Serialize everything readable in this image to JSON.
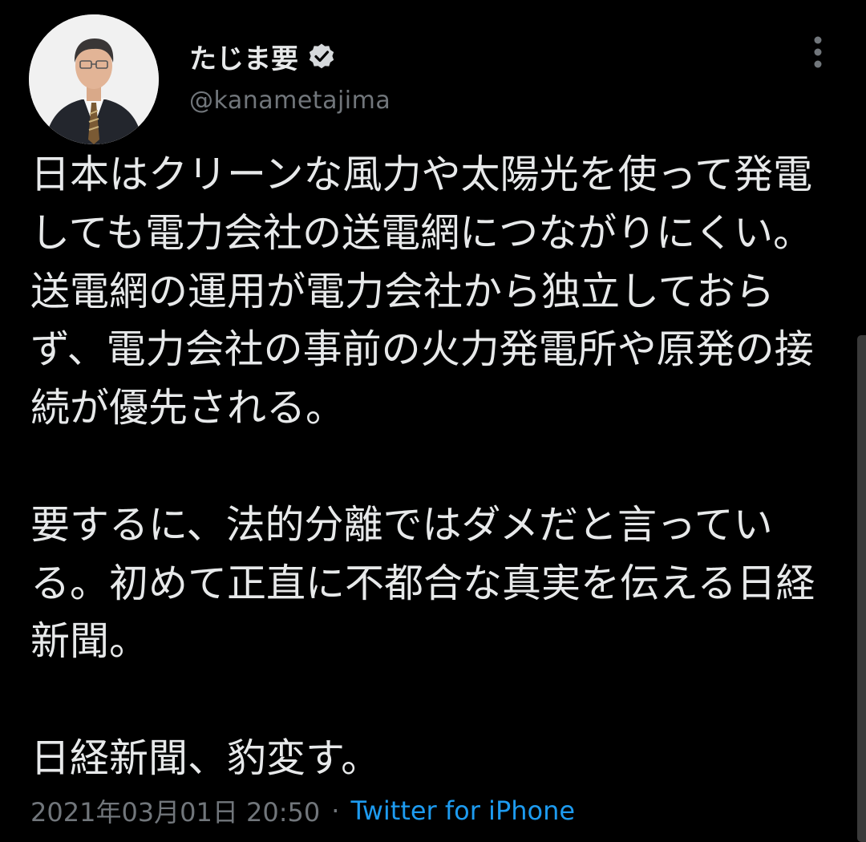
{
  "author": {
    "display_name": "たじま要",
    "handle": "@kanametajima",
    "avatar_icon": "user-avatar-photo",
    "verified_icon": "verified-badge-icon"
  },
  "menu": {
    "more_icon": "vertical-ellipsis-icon"
  },
  "tweet": {
    "paragraphs": [
      "日本はクリーンな風力や太陽光を使って発電しても電力会社の送電網につながりにくい。送電網の運用が電力会社から独立しておらず、電力会社の事前の火力発電所や原発の接続が優先される。",
      "要するに、法的分離ではダメだと言っている。初めて正直に不都合な真実を伝える日経新聞。",
      "日経新聞、豹変す。"
    ]
  },
  "meta": {
    "timestamp": "2021年03月01日 20:50",
    "separator": "·",
    "source": "Twitter for iPhone"
  },
  "colors": {
    "background": "#000000",
    "text": "#e7e9ea",
    "secondary": "#71767b",
    "link": "#1d9bf0"
  }
}
